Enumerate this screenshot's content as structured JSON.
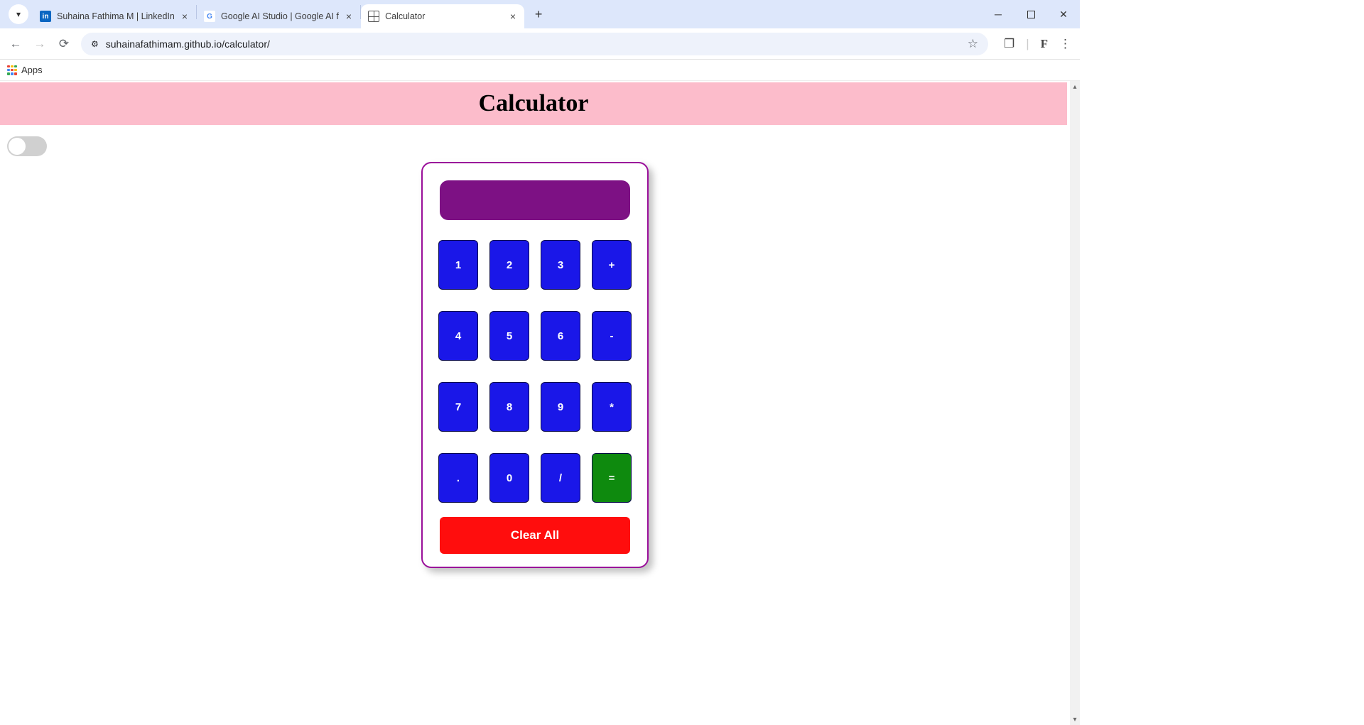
{
  "chrome": {
    "tabs": [
      {
        "title": "Suhaina Fathima M | LinkedIn",
        "fav": "in"
      },
      {
        "title": "Google AI Studio  |  Google AI f",
        "fav": "G"
      },
      {
        "title": "Calculator",
        "fav": "globe",
        "active": true
      }
    ],
    "url": "suhainafathimam.github.io/calculator/",
    "bookmarks": {
      "apps": "Apps"
    },
    "profile_initial": "F"
  },
  "page": {
    "header_title": "Calculator",
    "display_value": "",
    "keys": [
      "1",
      "2",
      "3",
      "+",
      "4",
      "5",
      "6",
      "-",
      "7",
      "8",
      "9",
      "*",
      ".",
      "0",
      "/",
      "="
    ],
    "clear_label": "Clear All"
  }
}
